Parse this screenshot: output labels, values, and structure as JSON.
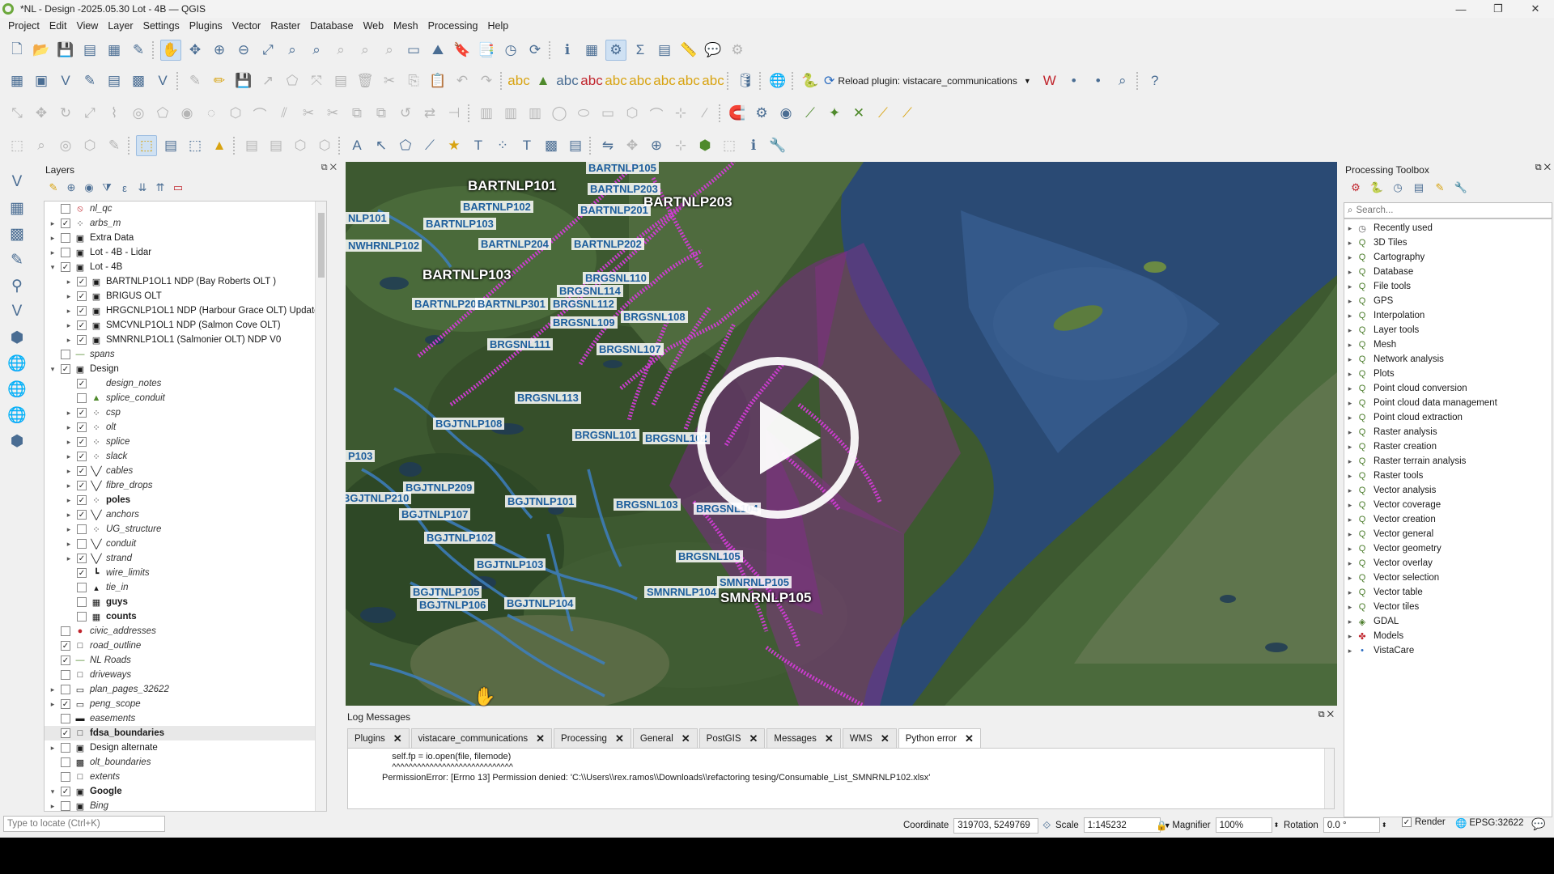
{
  "window": {
    "title": "*NL - Design -2025.05.30 Lot - 4B — QGIS",
    "controls": [
      "—",
      "❐",
      "✕"
    ]
  },
  "menu": [
    "Project",
    "Edit",
    "View",
    "Layer",
    "Settings",
    "Plugins",
    "Vector",
    "Raster",
    "Database",
    "Web",
    "Mesh",
    "Processing",
    "Help"
  ],
  "toolbar": {
    "reload_plugin_label": "Reload plugin: vistacare_communications"
  },
  "layers_panel": {
    "title": "Layers",
    "items": [
      {
        "name": "nl_qc",
        "level": 0,
        "checked": false,
        "expand": "",
        "icon": "⦸",
        "style": "it"
      },
      {
        "name": "arbs_m",
        "level": 0,
        "checked": true,
        "expand": "▸",
        "icon": "⁘",
        "style": "it"
      },
      {
        "name": "Extra Data",
        "level": 0,
        "checked": false,
        "expand": "▸",
        "icon": "▣",
        "style": ""
      },
      {
        "name": "Lot - 4B - Lidar",
        "level": 0,
        "checked": false,
        "expand": "▸",
        "icon": "▣",
        "style": ""
      },
      {
        "name": "Lot - 4B",
        "level": 0,
        "checked": true,
        "expand": "▾",
        "icon": "▣",
        "style": ""
      },
      {
        "name": "BARTNLP1OL1 NDP (Bay Roberts OLT )",
        "level": 1,
        "checked": true,
        "expand": "▸",
        "icon": "▣",
        "style": ""
      },
      {
        "name": "BRIGUS OLT",
        "level": 1,
        "checked": true,
        "expand": "▸",
        "icon": "▣",
        "style": ""
      },
      {
        "name": "HRGCNLP1OL1 NDP (Harbour Grace OLT) Update",
        "level": 1,
        "checked": true,
        "expand": "▸",
        "icon": "▣",
        "style": ""
      },
      {
        "name": "SMCVNLP1OL1 NDP (Salmon Cove OLT)",
        "level": 1,
        "checked": true,
        "expand": "▸",
        "icon": "▣",
        "style": ""
      },
      {
        "name": "SMNRNLP1OL1 (Salmonier OLT) NDP V0",
        "level": 1,
        "checked": true,
        "expand": "▸",
        "icon": "▣",
        "style": ""
      },
      {
        "name": "spans",
        "level": 0,
        "checked": false,
        "expand": "",
        "icon": "—",
        "style": "it"
      },
      {
        "name": "Design",
        "level": 0,
        "checked": true,
        "expand": "▾",
        "icon": "▣",
        "style": ""
      },
      {
        "name": "design_notes",
        "level": 1,
        "checked": true,
        "expand": "",
        "icon": "",
        "style": "it"
      },
      {
        "name": "splice_conduit",
        "level": 1,
        "checked": false,
        "expand": "",
        "icon": "▲",
        "style": "it"
      },
      {
        "name": "csp",
        "level": 1,
        "checked": true,
        "expand": "▸",
        "icon": "⁘",
        "style": "it"
      },
      {
        "name": "olt",
        "level": 1,
        "checked": true,
        "expand": "▸",
        "icon": "⁘",
        "style": "it"
      },
      {
        "name": "splice",
        "level": 1,
        "checked": true,
        "expand": "▸",
        "icon": "⁘",
        "style": "it"
      },
      {
        "name": "slack",
        "level": 1,
        "checked": true,
        "expand": "▸",
        "icon": "⁘",
        "style": "it"
      },
      {
        "name": "cables",
        "level": 1,
        "checked": true,
        "expand": "▸",
        "icon": "╲╱",
        "style": "it"
      },
      {
        "name": "fibre_drops",
        "level": 1,
        "checked": true,
        "expand": "▸",
        "icon": "╲╱",
        "style": "it"
      },
      {
        "name": "poles",
        "level": 1,
        "checked": true,
        "expand": "▸",
        "icon": "⁘",
        "style": "b"
      },
      {
        "name": "anchors",
        "level": 1,
        "checked": true,
        "expand": "▸",
        "icon": "╲╱",
        "style": "it"
      },
      {
        "name": "UG_structure",
        "level": 1,
        "checked": false,
        "expand": "▸",
        "icon": "⁘",
        "style": "it"
      },
      {
        "name": "conduit",
        "level": 1,
        "checked": false,
        "expand": "▸",
        "icon": "╲╱",
        "style": "it"
      },
      {
        "name": "strand",
        "level": 1,
        "checked": true,
        "expand": "▸",
        "icon": "╲╱",
        "style": "it"
      },
      {
        "name": "wire_limits",
        "level": 1,
        "checked": true,
        "expand": "",
        "icon": "┗",
        "style": "it"
      },
      {
        "name": "tie_in",
        "level": 1,
        "checked": false,
        "expand": "",
        "icon": "▴",
        "style": "it"
      },
      {
        "name": "guys",
        "level": 1,
        "checked": false,
        "expand": "",
        "icon": "▦",
        "style": "b"
      },
      {
        "name": "counts",
        "level": 1,
        "checked": false,
        "expand": "",
        "icon": "▦",
        "style": "b"
      },
      {
        "name": "civic_addresses",
        "level": 0,
        "checked": false,
        "expand": "",
        "icon": "●",
        "style": "it"
      },
      {
        "name": "road_outline",
        "level": 0,
        "checked": true,
        "expand": "",
        "icon": "□",
        "style": "it"
      },
      {
        "name": "NL Roads",
        "level": 0,
        "checked": true,
        "expand": "",
        "icon": "—",
        "style": "it"
      },
      {
        "name": "driveways",
        "level": 0,
        "checked": false,
        "expand": "",
        "icon": "□",
        "style": "it"
      },
      {
        "name": "plan_pages_32622",
        "level": 0,
        "checked": false,
        "expand": "▸",
        "icon": "▭",
        "style": "it"
      },
      {
        "name": "peng_scope",
        "level": 0,
        "checked": true,
        "expand": "▸",
        "icon": "▭",
        "style": "it"
      },
      {
        "name": "easements",
        "level": 0,
        "checked": false,
        "expand": "",
        "icon": "▬",
        "style": "it"
      },
      {
        "name": "fdsa_boundaries",
        "level": 0,
        "checked": true,
        "expand": "",
        "icon": "□",
        "style": "b",
        "selected": true
      },
      {
        "name": "Design alternate",
        "level": 0,
        "checked": false,
        "expand": "▸",
        "icon": "▣",
        "style": ""
      },
      {
        "name": "olt_boundaries",
        "level": 0,
        "checked": false,
        "expand": "",
        "icon": "▩",
        "style": "it"
      },
      {
        "name": "extents",
        "level": 0,
        "checked": false,
        "expand": "",
        "icon": "□",
        "style": "it"
      },
      {
        "name": "Google",
        "level": 0,
        "checked": true,
        "expand": "▾",
        "icon": "▣",
        "style": "b"
      },
      {
        "name": "Bing",
        "level": 0,
        "checked": false,
        "expand": "▸",
        "icon": "▣",
        "style": "it"
      }
    ],
    "locate_placeholder": "Type to locate (Ctrl+K)"
  },
  "map": {
    "labels": [
      {
        "t": "BARTNLP105",
        "big": false
      },
      {
        "t": "BARTNLP101",
        "big": true
      },
      {
        "t": "BARTNLP203",
        "big": false
      },
      {
        "t": "BARTNLP203",
        "big": true
      },
      {
        "t": "BARTNLP102",
        "big": false
      },
      {
        "t": "BARTNLP201",
        "big": false
      },
      {
        "t": "NLP101",
        "big": false
      },
      {
        "t": "BARTNLP103",
        "big": false
      },
      {
        "t": "NWHRNLP102",
        "big": false
      },
      {
        "t": "BARTNLP204",
        "big": false
      },
      {
        "t": "BARTNLP202",
        "big": false
      },
      {
        "t": "BARTNLP103",
        "big": true
      },
      {
        "t": "BRGSNL110",
        "big": false
      },
      {
        "t": "BRGSNL114",
        "big": false
      },
      {
        "t": "BRGSNL112",
        "big": false
      },
      {
        "t": "BARTNLP205",
        "big": false
      },
      {
        "t": "BARTNLP301",
        "big": false
      },
      {
        "t": "BRGSNL109",
        "big": false
      },
      {
        "t": "BRGSNL108",
        "big": false
      },
      {
        "t": "BRGSNL111",
        "big": false
      },
      {
        "t": "BRGSNL107",
        "big": false
      },
      {
        "t": "BRGSNL113",
        "big": false
      },
      {
        "t": "BGJTNLP108",
        "big": false
      },
      {
        "t": "BRGSNL101",
        "big": false
      },
      {
        "t": "BRGSNL102",
        "big": false
      },
      {
        "t": "P103",
        "big": false
      },
      {
        "t": "BGJTNLP209",
        "big": false
      },
      {
        "t": "BGJTNLP210",
        "big": false
      },
      {
        "t": "BGJTNLP101",
        "big": false
      },
      {
        "t": "BRGSNL103",
        "big": false
      },
      {
        "t": "BRGSNL104",
        "big": false
      },
      {
        "t": "BGJTNLP107",
        "big": false
      },
      {
        "t": "BGJTNLP102",
        "big": false
      },
      {
        "t": "BRGSNL105",
        "big": false
      },
      {
        "t": "BGJTNLP103",
        "big": false
      },
      {
        "t": "SMNRNLP105",
        "big": false
      },
      {
        "t": "BGJTNLP105",
        "big": false
      },
      {
        "t": "SMNRNLP104",
        "big": false
      },
      {
        "t": "SMNRNLP105",
        "big": true
      },
      {
        "t": "BGJTNLP106",
        "big": false
      },
      {
        "t": "BGJTNLP104",
        "big": false
      }
    ]
  },
  "processing_toolbox": {
    "title": "Processing Toolbox",
    "search_placeholder": "Search...",
    "items": [
      {
        "label": "Recently used",
        "icon": "◷"
      },
      {
        "label": "3D Tiles",
        "icon": "Q"
      },
      {
        "label": "Cartography",
        "icon": "Q"
      },
      {
        "label": "Database",
        "icon": "Q"
      },
      {
        "label": "File tools",
        "icon": "Q"
      },
      {
        "label": "GPS",
        "icon": "Q"
      },
      {
        "label": "Interpolation",
        "icon": "Q"
      },
      {
        "label": "Layer tools",
        "icon": "Q"
      },
      {
        "label": "Mesh",
        "icon": "Q"
      },
      {
        "label": "Network analysis",
        "icon": "Q"
      },
      {
        "label": "Plots",
        "icon": "Q"
      },
      {
        "label": "Point cloud conversion",
        "icon": "Q"
      },
      {
        "label": "Point cloud data management",
        "icon": "Q"
      },
      {
        "label": "Point cloud extraction",
        "icon": "Q"
      },
      {
        "label": "Raster analysis",
        "icon": "Q"
      },
      {
        "label": "Raster creation",
        "icon": "Q"
      },
      {
        "label": "Raster terrain analysis",
        "icon": "Q"
      },
      {
        "label": "Raster tools",
        "icon": "Q"
      },
      {
        "label": "Vector analysis",
        "icon": "Q"
      },
      {
        "label": "Vector coverage",
        "icon": "Q"
      },
      {
        "label": "Vector creation",
        "icon": "Q"
      },
      {
        "label": "Vector general",
        "icon": "Q"
      },
      {
        "label": "Vector geometry",
        "icon": "Q"
      },
      {
        "label": "Vector overlay",
        "icon": "Q"
      },
      {
        "label": "Vector selection",
        "icon": "Q"
      },
      {
        "label": "Vector table",
        "icon": "Q"
      },
      {
        "label": "Vector tiles",
        "icon": "Q"
      },
      {
        "label": "GDAL",
        "icon": "◈"
      },
      {
        "label": "Models",
        "icon": "✤"
      },
      {
        "label": "VistaCare",
        "icon": "•"
      }
    ]
  },
  "log_panel": {
    "title": "Log Messages",
    "tabs": [
      "Plugins",
      "vistacare_communications",
      "Processing",
      "General",
      "PostGIS",
      "Messages",
      "WMS",
      "Python error"
    ],
    "active_tab": "Python error",
    "lines": [
      "    self.fp = io.open(file, filemode)",
      "    ^^^^^^^^^^^^^^^^^^^^^^^^^^^^^",
      "PermissionError: [Errno 13] Permission denied: 'C:\\\\Users\\\\rex.ramos\\\\Downloads\\\\refactoring tesing/Consumable_List_SMNRNLP102.xlsx'"
    ]
  },
  "statusbar": {
    "coordinate_label": "Coordinate",
    "coordinate_value": "319703, 5249769",
    "scale_label": "Scale",
    "scale_value": "1:145232",
    "magnifier_label": "Magnifier",
    "magnifier_value": "100%",
    "rotation_label": "Rotation",
    "rotation_value": "0.0 °",
    "render_label": "Render",
    "crs_label": "EPSG:32622"
  }
}
